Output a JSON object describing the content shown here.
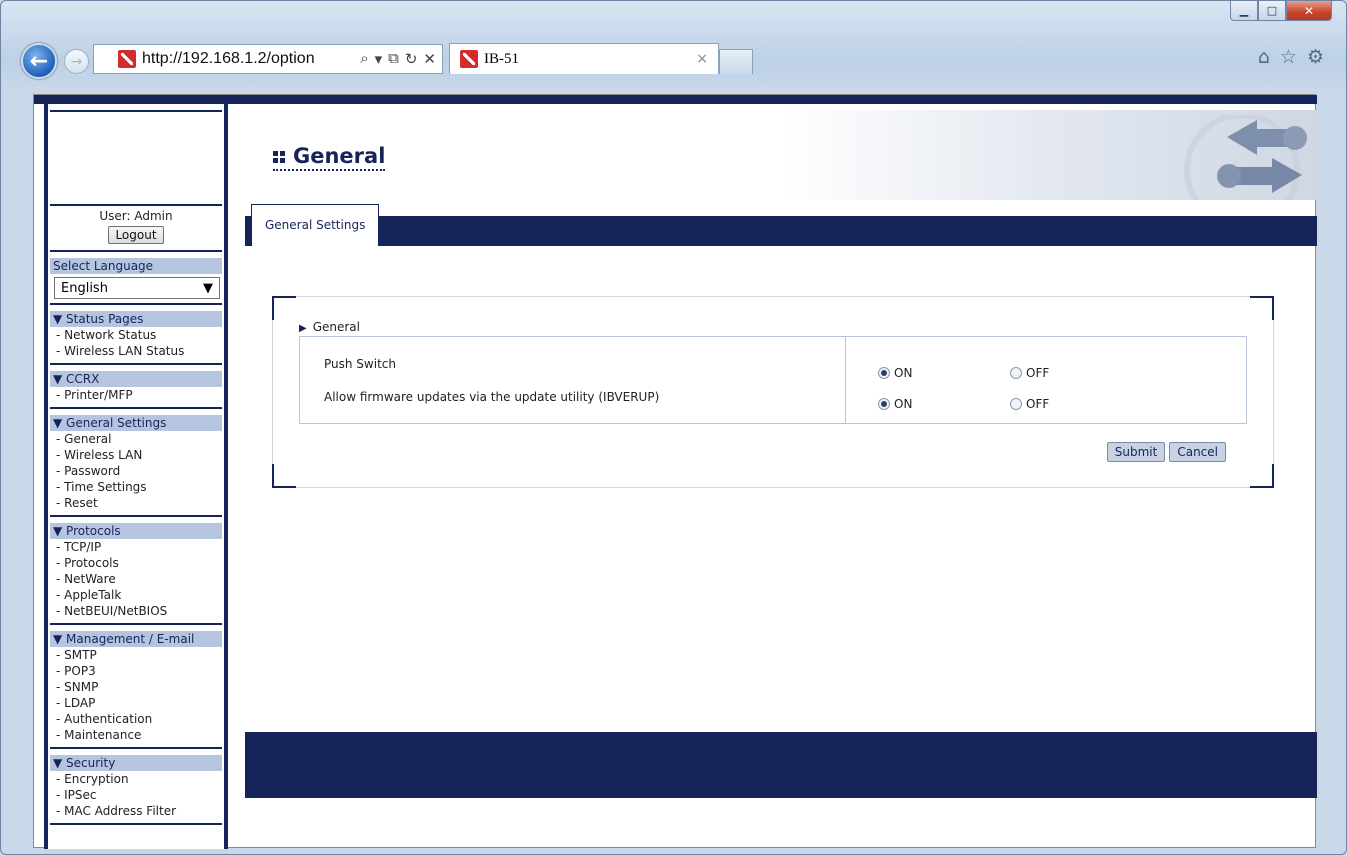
{
  "browser": {
    "address_url": "http://192.168.1.2/option",
    "tab_title": "IB-51",
    "tab_close": "×"
  },
  "sidebar": {
    "user_label": "User: Admin",
    "logout_label": "Logout",
    "language_heading": "Select Language",
    "language_selected": "English",
    "sections": [
      {
        "heading": "▼ Status Pages",
        "items": [
          "- Network Status",
          "- Wireless LAN Status"
        ]
      },
      {
        "heading": "▼ CCRX",
        "items": [
          "- Printer/MFP"
        ]
      },
      {
        "heading": "▼ General Settings",
        "items": [
          "- General",
          "- Wireless LAN",
          "- Password",
          "- Time Settings",
          "- Reset"
        ]
      },
      {
        "heading": "▼ Protocols",
        "items": [
          "- TCP/IP",
          "- Protocols",
          "- NetWare",
          "- AppleTalk",
          "- NetBEUI/NetBIOS"
        ]
      },
      {
        "heading": "▼ Management / E-mail",
        "items": [
          "- SMTP",
          "- POP3",
          "- SNMP",
          "- LDAP",
          "- Authentication",
          "- Maintenance"
        ]
      },
      {
        "heading": "▼ Security",
        "items": [
          "- Encryption",
          "- IPSec",
          "- MAC Address Filter"
        ]
      }
    ]
  },
  "main": {
    "page_title": "General",
    "tab_label": "General Settings",
    "section_label": "General",
    "settings": [
      {
        "label": "Push Switch",
        "on_label": "ON",
        "off_label": "OFF",
        "value": "ON"
      },
      {
        "label": "Allow firmware updates via the update utility (IBVERUP)",
        "on_label": "ON",
        "off_label": "OFF",
        "value": "ON"
      }
    ],
    "submit_label": "Submit",
    "cancel_label": "Cancel"
  },
  "colors": {
    "navy": "#17245a",
    "sidebar_head": "#b5c5df"
  }
}
